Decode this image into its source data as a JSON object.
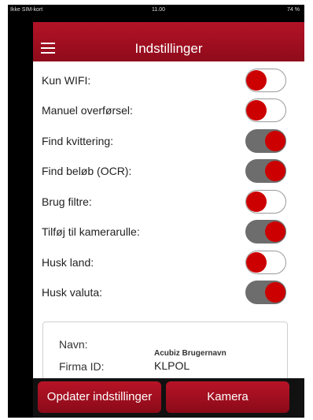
{
  "status_bar": {
    "carrier": "Ikke SIM-kort",
    "time": "11.00",
    "battery": "74 %"
  },
  "header": {
    "title": "Indstillinger",
    "menu_icon": "hamburger-menu-icon"
  },
  "colors": {
    "accent": "#b31326",
    "toggle_knob": "#cc0000",
    "toggle_on_track": "#6d6d6d"
  },
  "settings": [
    {
      "label": "Kun WIFI:",
      "on": false
    },
    {
      "label": "Manuel overførsel:",
      "on": false
    },
    {
      "label": "Find kvittering:",
      "on": true
    },
    {
      "label": "Find beløb (OCR):",
      "on": true
    },
    {
      "label": "Brug filtre:",
      "on": false
    },
    {
      "label": "Tilføj til kamerarulle:",
      "on": true
    },
    {
      "label": "Husk land:",
      "on": false
    },
    {
      "label": "Husk valuta:",
      "on": true
    }
  ],
  "account": {
    "name_label": "Navn:",
    "name_value": "Acubiz Brugernavn",
    "company_label": "Firma ID:",
    "company_value": "KLPOL"
  },
  "buttons": {
    "update": "Opdater indstillinger",
    "camera": "Kamera"
  }
}
